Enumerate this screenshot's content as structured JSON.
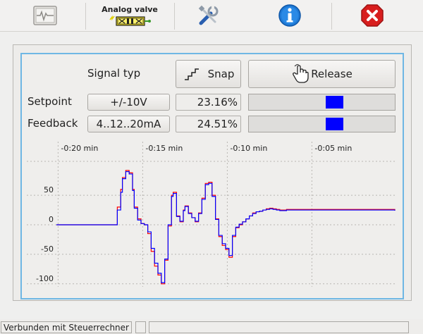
{
  "toolbar": {
    "analog_valve_label": "Analog valve",
    "icons": [
      "monitor-icon",
      "analog-valve-icon",
      "tools-icon",
      "info-icon",
      "close-icon"
    ]
  },
  "controls": {
    "signal_typ_label": "Signal typ",
    "snap_label": "Snap",
    "release_label": "Release",
    "setpoint_label": "Setpoint",
    "setpoint_range": "+/-10V",
    "setpoint_value": "23.16%",
    "setpoint_level": 0.6,
    "feedback_label": "Feedback",
    "feedback_range": "4..12..20mA",
    "feedback_value": "24.51%",
    "feedback_level": 0.6
  },
  "colors": {
    "accent_border": "#6fb7e4",
    "bar_fill": "#0000ff",
    "setpoint_line": "#ff0000",
    "feedback_line": "#0000ff"
  },
  "chart_data": {
    "type": "line",
    "x_tick_labels": [
      "-0:20 min",
      "-0:15 min",
      "-0:10 min",
      "-0:05 min"
    ],
    "y_tick_labels": [
      "50",
      "0",
      "-50",
      "-100"
    ],
    "ylim": [
      -105,
      105
    ],
    "xlim": [
      -20.1,
      -0.1
    ],
    "grid": true,
    "series": [
      {
        "color": "#ff0000",
        "x": [
          -20.1,
          -16.7,
          -16.5,
          -16.3,
          -16.2,
          -16.0,
          -15.8,
          -15.6,
          -15.5,
          -15.3,
          -15.1,
          -14.9,
          -14.7,
          -14.5,
          -14.3,
          -14.1,
          -13.9,
          -13.7,
          -13.5,
          -13.3,
          -13.2,
          -13.0,
          -12.8,
          -12.6,
          -12.5,
          -12.3,
          -12.1,
          -11.9,
          -11.7,
          -11.5,
          -11.3,
          -11.1,
          -10.9,
          -10.7,
          -10.5,
          -10.3,
          -10.1,
          -9.9,
          -9.7,
          -9.5,
          -9.3,
          -9.1,
          -8.9,
          -8.7,
          -8.5,
          -8.3,
          -8.1,
          -7.9,
          -7.7,
          -7.5,
          -7.3,
          -7.1,
          -6.9,
          -6.5,
          -0.1
        ],
        "y": [
          0,
          0,
          30,
          60,
          80,
          92,
          88,
          60,
          30,
          10,
          2,
          0,
          -15,
          -45,
          -70,
          -85,
          -100,
          -60,
          -2,
          50,
          55,
          15,
          5,
          25,
          32,
          20,
          12,
          5,
          20,
          45,
          70,
          72,
          50,
          10,
          -20,
          -35,
          -42,
          -55,
          -20,
          -5,
          0,
          5,
          10,
          15,
          20,
          22,
          23,
          25,
          27,
          28,
          27,
          26,
          25,
          26,
          24
        ]
      },
      {
        "color": "#0000ff",
        "x": [
          -20.1,
          -16.7,
          -16.5,
          -16.3,
          -16.2,
          -16.0,
          -15.8,
          -15.6,
          -15.5,
          -15.3,
          -15.1,
          -14.9,
          -14.7,
          -14.5,
          -14.3,
          -14.1,
          -13.9,
          -13.7,
          -13.5,
          -13.3,
          -13.2,
          -13.0,
          -12.8,
          -12.6,
          -12.5,
          -12.3,
          -12.1,
          -11.9,
          -11.7,
          -11.5,
          -11.3,
          -11.1,
          -10.9,
          -10.7,
          -10.5,
          -10.3,
          -10.1,
          -9.9,
          -9.7,
          -9.5,
          -9.3,
          -9.1,
          -8.9,
          -8.7,
          -8.5,
          -8.3,
          -8.1,
          -7.9,
          -7.7,
          -7.5,
          -7.3,
          -7.1,
          -6.9,
          -6.5,
          -0.1
        ],
        "y": [
          0,
          0,
          25,
          55,
          78,
          90,
          86,
          58,
          28,
          8,
          2,
          0,
          -12,
          -40,
          -65,
          -82,
          -98,
          -58,
          0,
          48,
          53,
          14,
          6,
          24,
          31,
          19,
          12,
          6,
          19,
          43,
          68,
          70,
          48,
          9,
          -18,
          -32,
          -40,
          -52,
          -18,
          -4,
          1,
          5,
          10,
          15,
          19,
          22,
          23,
          25,
          26,
          27,
          26,
          25,
          24,
          25,
          24
        ]
      }
    ]
  },
  "statusbar": {
    "connection_text": "Verbunden mit Steuerrechner"
  }
}
